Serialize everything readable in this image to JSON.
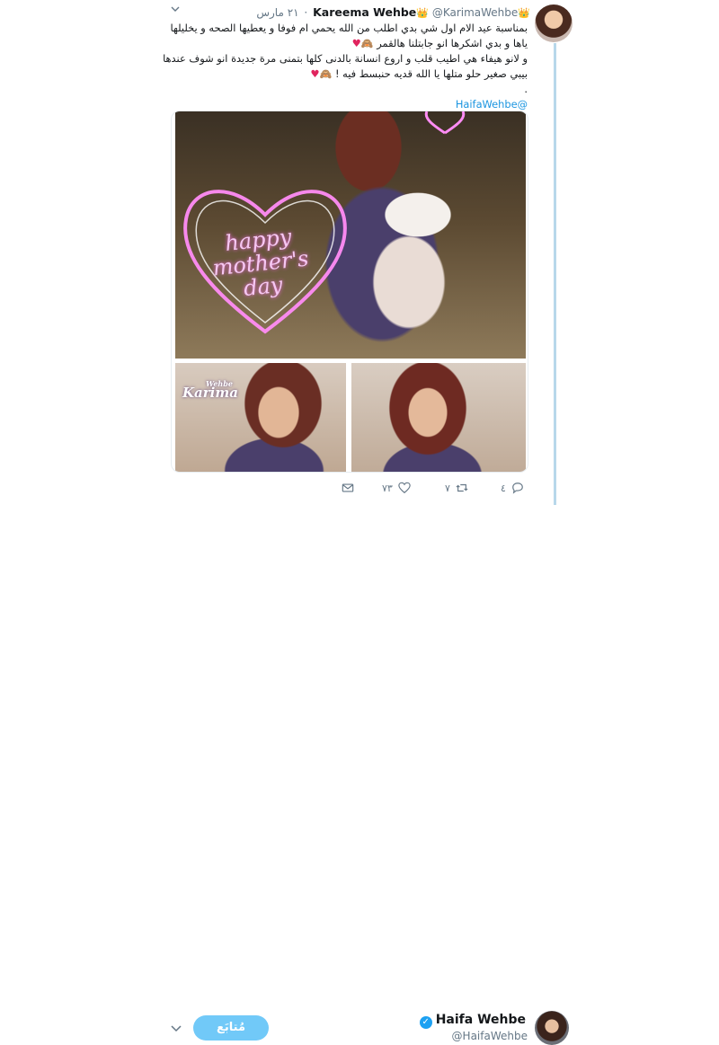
{
  "tweet": {
    "name": "Kareema Wehbe",
    "crown_left": "👑",
    "crown_right": "👑",
    "handle": "@KarimaWehbe",
    "dot": "·",
    "date": "٢١ مارس",
    "lines": [
      "بمناسبة عيد الام اول شي بدي اطلب من الله يحمي ام فوفا و يعطيها الصحه و يخليلها",
      "ياها و بدي اشكرها انو جابتلنا هالقمر",
      "و لانو هيفاء هي اطيب قلب و اروع انسانة بالدنى كلها بتمنى مرة جديدة انو شوف عندها",
      "بيبي صغير حلو متلها يا الله قديه حنبسط فيه !",
      "."
    ],
    "line2_emoji": "🙈",
    "line2_heart": "♥",
    "line4_emoji": "🙈",
    "line4_heart": "♥",
    "mention": "@HaifaWehbe",
    "image_text": [
      "happy",
      "mother's",
      "day"
    ],
    "watermark_small": "Wehbe",
    "watermark": "Karima",
    "actions": {
      "replies": "٤",
      "retweets": "٧",
      "likes": "٧٣"
    }
  },
  "next_tweet": {
    "name": "Haifa Wehbe",
    "handle": "@HaifaWehbe",
    "follow_label": "مُتابَع"
  },
  "colors": {
    "accent": "#1b95e0",
    "follow_button": "#71c9f8",
    "thread_line": "#b8d8ea",
    "heart": "#e0245e"
  }
}
